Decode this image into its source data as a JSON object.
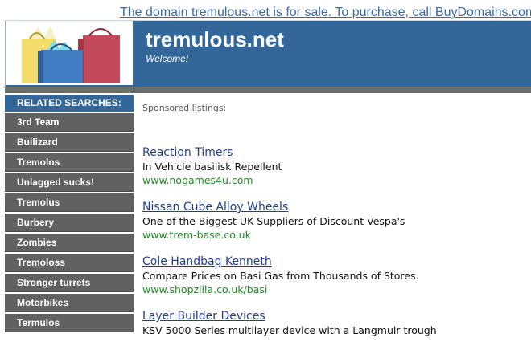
{
  "banner_text": "The domain tremulous.net is for sale. To purchase, call BuyDomains.com at",
  "header": {
    "title": "tremulous.net",
    "subtitle": "Welcome!",
    "logo_icon": "shopping-bags-icon"
  },
  "sidebar": {
    "heading": "RELATED SEARCHES:",
    "items": [
      {
        "label": "3rd Team"
      },
      {
        "label": "Builizard"
      },
      {
        "label": "Tremolos"
      },
      {
        "label": "Unlagged sucks!"
      },
      {
        "label": "Tremolus"
      },
      {
        "label": "Burbery"
      },
      {
        "label": "Zombies"
      },
      {
        "label": "Tremoloss"
      },
      {
        "label": "Stronger turrets"
      },
      {
        "label": "Motorbikes"
      },
      {
        "label": "Termulos"
      }
    ]
  },
  "main": {
    "sponsored_label": "Sponsored listings:",
    "listings": [
      {
        "title": "Reaction Timers",
        "desc": "In Vehicle basilisk Repellent",
        "url": "www.nogames4u.com"
      },
      {
        "title": "Nissan Cube Alloy Wheels",
        "desc": "One of the Biggest UK Suppliers of Discount Vespa's",
        "url": "www.trem-base.co.uk"
      },
      {
        "title": "Cole Handbag Kenneth",
        "desc": "Compare Prices on Basi Gas from Thousands of Stores.",
        "url": "www.shopzilla.co.uk/basi"
      },
      {
        "title": "Layer Builder Devices",
        "desc": "KSV 5000 Series multilayer device with a Langmuir trough",
        "url": ""
      }
    ]
  },
  "colors": {
    "header_blue": "#336699",
    "sidebar_gray": "#616161",
    "link_blue": "#1f3f8f",
    "url_green": "#1e8a24"
  }
}
